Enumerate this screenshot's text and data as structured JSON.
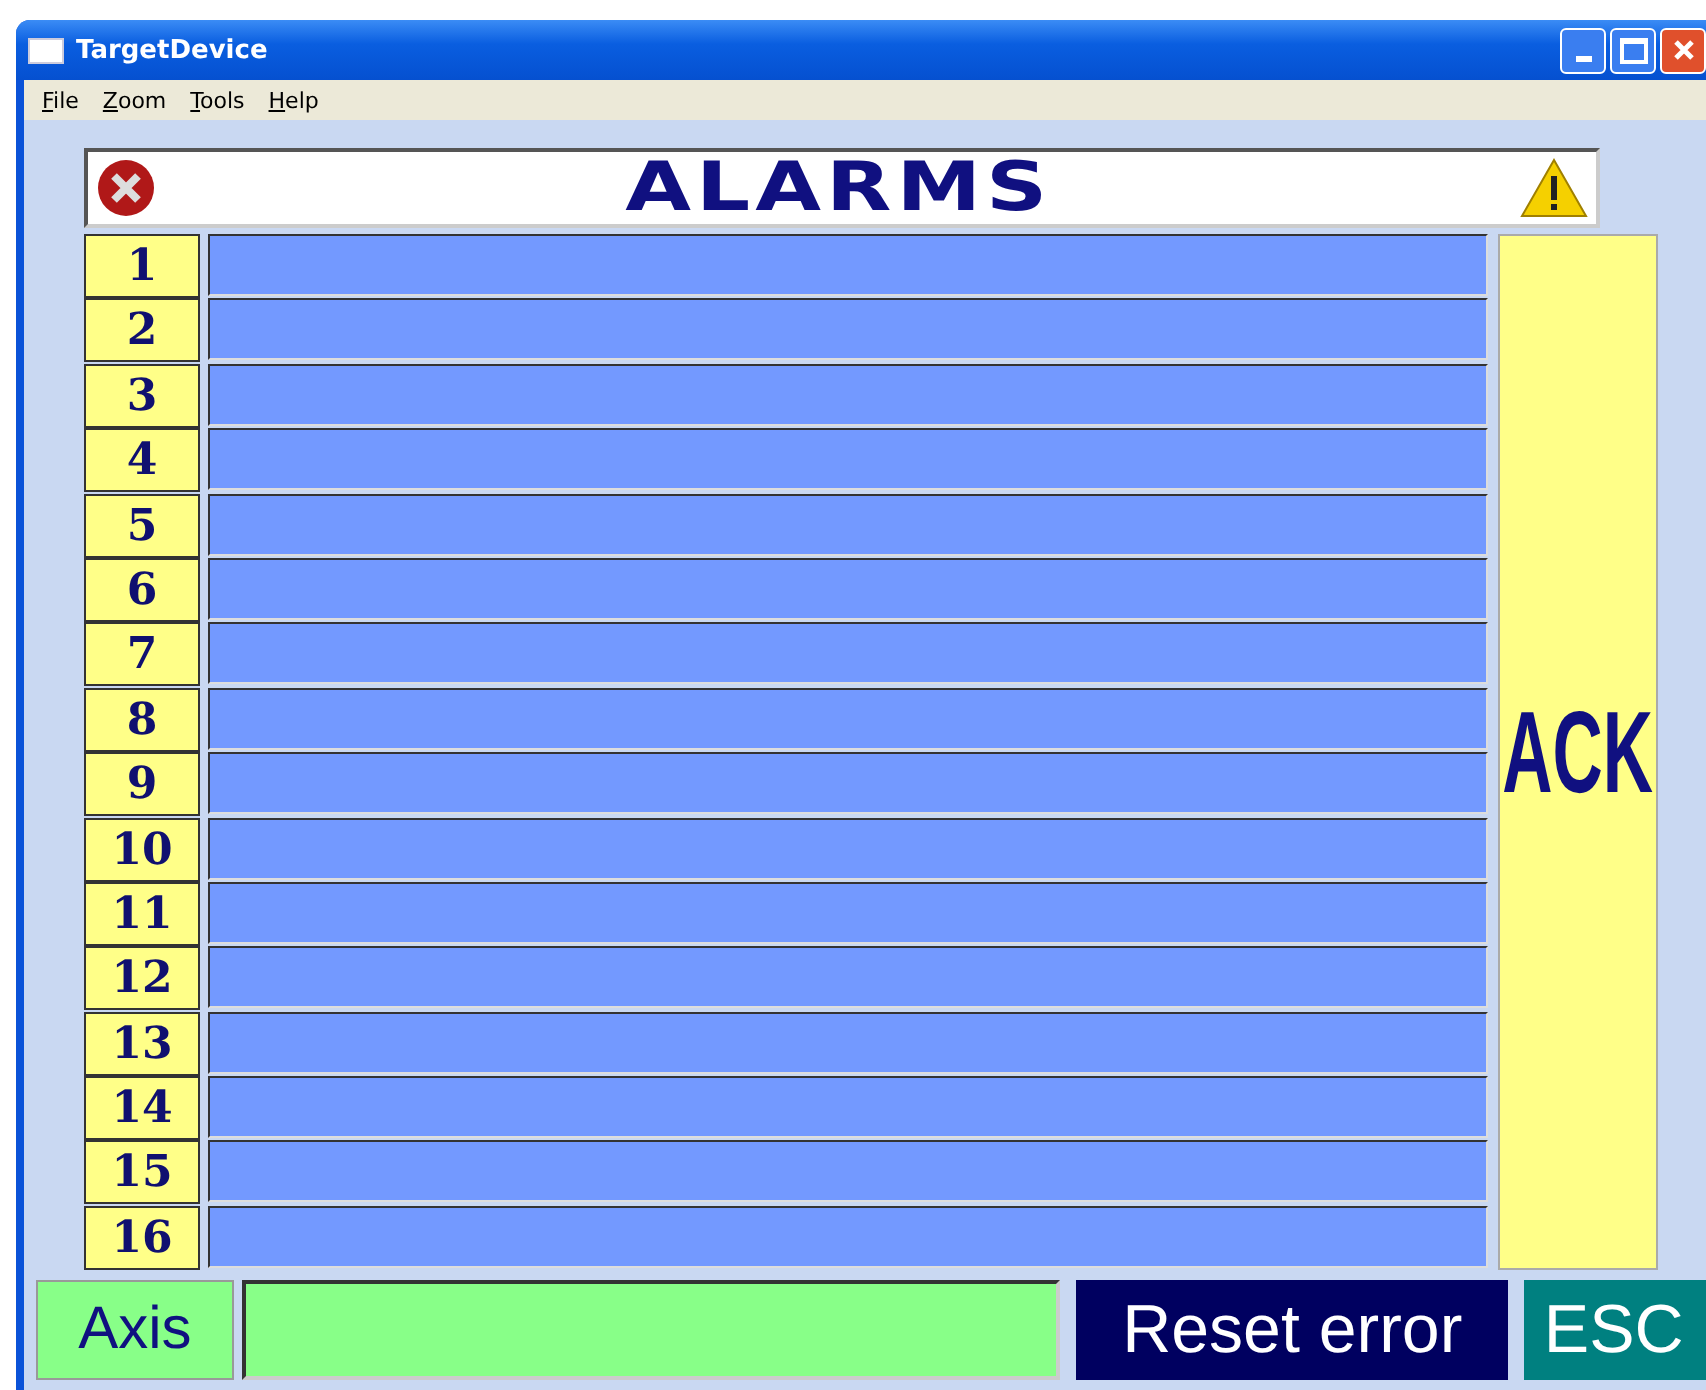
{
  "window": {
    "title": "TargetDevice"
  },
  "menu": [
    {
      "label": "File"
    },
    {
      "label": "Zoom"
    },
    {
      "label": "Tools"
    },
    {
      "label": "Help"
    }
  ],
  "header": {
    "title": "ALARMS"
  },
  "alarms": [
    {
      "number": "1"
    },
    {
      "number": "2"
    },
    {
      "number": "3"
    },
    {
      "number": "4"
    },
    {
      "number": "5"
    },
    {
      "number": "6"
    },
    {
      "number": "7"
    },
    {
      "number": "8"
    },
    {
      "number": "9"
    },
    {
      "number": "10"
    },
    {
      "number": "11"
    },
    {
      "number": "12"
    },
    {
      "number": "13"
    },
    {
      "number": "14"
    },
    {
      "number": "15"
    },
    {
      "number": "16"
    }
  ],
  "ack_button": "ACK",
  "bottom": {
    "axis_label": "Axis",
    "reset_button": "Reset error",
    "esc_button": "ESC"
  }
}
